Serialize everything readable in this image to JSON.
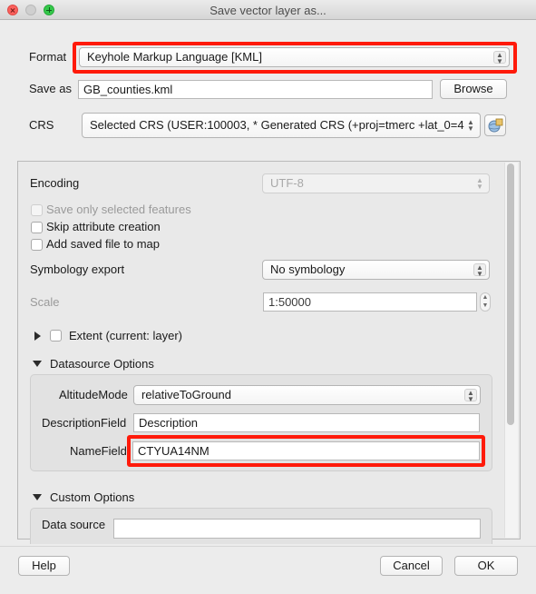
{
  "window": {
    "title": "Save vector layer as..."
  },
  "format": {
    "label": "Format",
    "value": "Keyhole Markup Language [KML]"
  },
  "save_as": {
    "label": "Save as",
    "value": "GB_counties.kml",
    "browse_label": "Browse"
  },
  "crs": {
    "label": "CRS",
    "value": "Selected CRS (USER:100003,  * Generated CRS (+proj=tmerc +lat_0=4"
  },
  "encoding": {
    "label": "Encoding",
    "value": "UTF-8"
  },
  "options": {
    "save_selected": "Save only selected features",
    "skip_attribute": "Skip attribute creation",
    "add_saved": "Add saved file to map"
  },
  "symbology": {
    "label": "Symbology export",
    "value": "No symbology"
  },
  "scale": {
    "label": "Scale",
    "value": "1:50000"
  },
  "extent": {
    "label": "Extent (current: layer)"
  },
  "datasource_options": {
    "title": "Datasource Options",
    "altitude_mode": {
      "label": "AltitudeMode",
      "value": "relativeToGround"
    },
    "description_field": {
      "label": "DescriptionField",
      "value": "Description"
    },
    "name_field": {
      "label": "NameField",
      "value": "CTYUA14NM"
    }
  },
  "custom_options": {
    "title": "Custom Options",
    "data_source_label": "Data source"
  },
  "footer": {
    "help_label": "Help",
    "cancel_label": "Cancel",
    "ok_label": "OK"
  },
  "colors": {
    "highlight": "#ff1a0a",
    "close": "#fc605c",
    "zoom": "#34c84a"
  }
}
